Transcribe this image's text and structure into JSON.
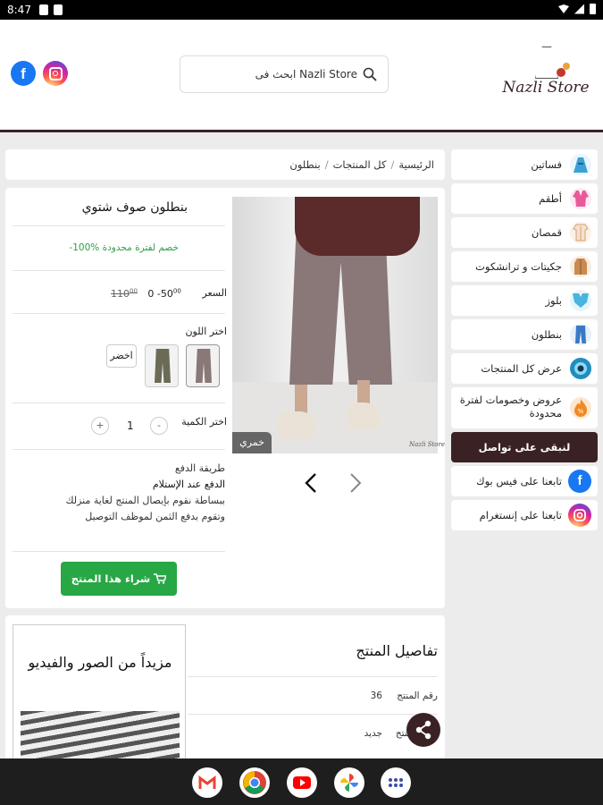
{
  "status": {
    "time": "8:47"
  },
  "header": {
    "logo_text": "Nazli Store",
    "search_text": "ابحث فى Nazli Store"
  },
  "sidebar": {
    "items": [
      {
        "label": "فساتين",
        "icon": "dress-icon",
        "color": "#3aa1d8"
      },
      {
        "label": "أطقم",
        "icon": "outfit-icon",
        "color": "#e85b9b"
      },
      {
        "label": "قمصان",
        "icon": "shirt-icon",
        "color": "#d9a36c"
      },
      {
        "label": "جكيتات و ترانشكوت",
        "icon": "jacket-icon",
        "color": "#c98b50"
      },
      {
        "label": "بلوز",
        "icon": "blouse-icon",
        "color": "#49b4e0"
      },
      {
        "label": "بنطلون",
        "icon": "pants-icon",
        "color": "#3a78c4"
      },
      {
        "label": "عرض كل المنتجات",
        "icon": "eye-icon",
        "color": "#1f8dbf"
      },
      {
        "label": "عروض وخصومات لفترة محدودة",
        "icon": "sale-fire-icon",
        "color": "#f08a24"
      }
    ],
    "contact_header": "لنبقى على تواصل",
    "social": [
      {
        "label": "تابعنا على فيس بوك",
        "icon": "facebook-icon"
      },
      {
        "label": "تابعنا على إنستغرام",
        "icon": "instagram-icon"
      }
    ]
  },
  "breadcrumb": {
    "home": "الرئيسية",
    "all": "كل المنتجات",
    "current": "بنطلون",
    "sep": "/"
  },
  "product": {
    "title": "بنطلون صوف شتوي",
    "discount": "-100% خصم لفترة محدودة",
    "price_label": "السعر",
    "price_new": "0 -50",
    "price_new_sup": "00",
    "price_old": "110",
    "price_old_sup": "00",
    "color_label": "اختر اللون",
    "color_swatch_text": "اخضر",
    "qty_label": "اختر الكمية",
    "qty_value": "1",
    "qty_minus": "-",
    "qty_plus": "+",
    "pay_title": "طريقة الدفع",
    "pay_method": "الدفع عند الإستلام",
    "pay_desc": "ببساطة نقوم بإيصال المنتج لغاية منزلك وتقوم بدفع الثمن لموظف التوصيل",
    "buy_label": "شراء هذا المنتج",
    "image_color_tag": "خمري",
    "watermark": "Nazli Store"
  },
  "details": {
    "title": "تفاصيل المنتج",
    "rows": [
      {
        "key": "رقم المنتج",
        "value": "36"
      },
      {
        "key": "حالة المنتج",
        "value": "جديد"
      }
    ],
    "more_media": "مزيداً من الصور والفيديو"
  },
  "colors": {
    "brand": "#3a2224",
    "green": "#28a745",
    "discount": "#2e9d48"
  }
}
